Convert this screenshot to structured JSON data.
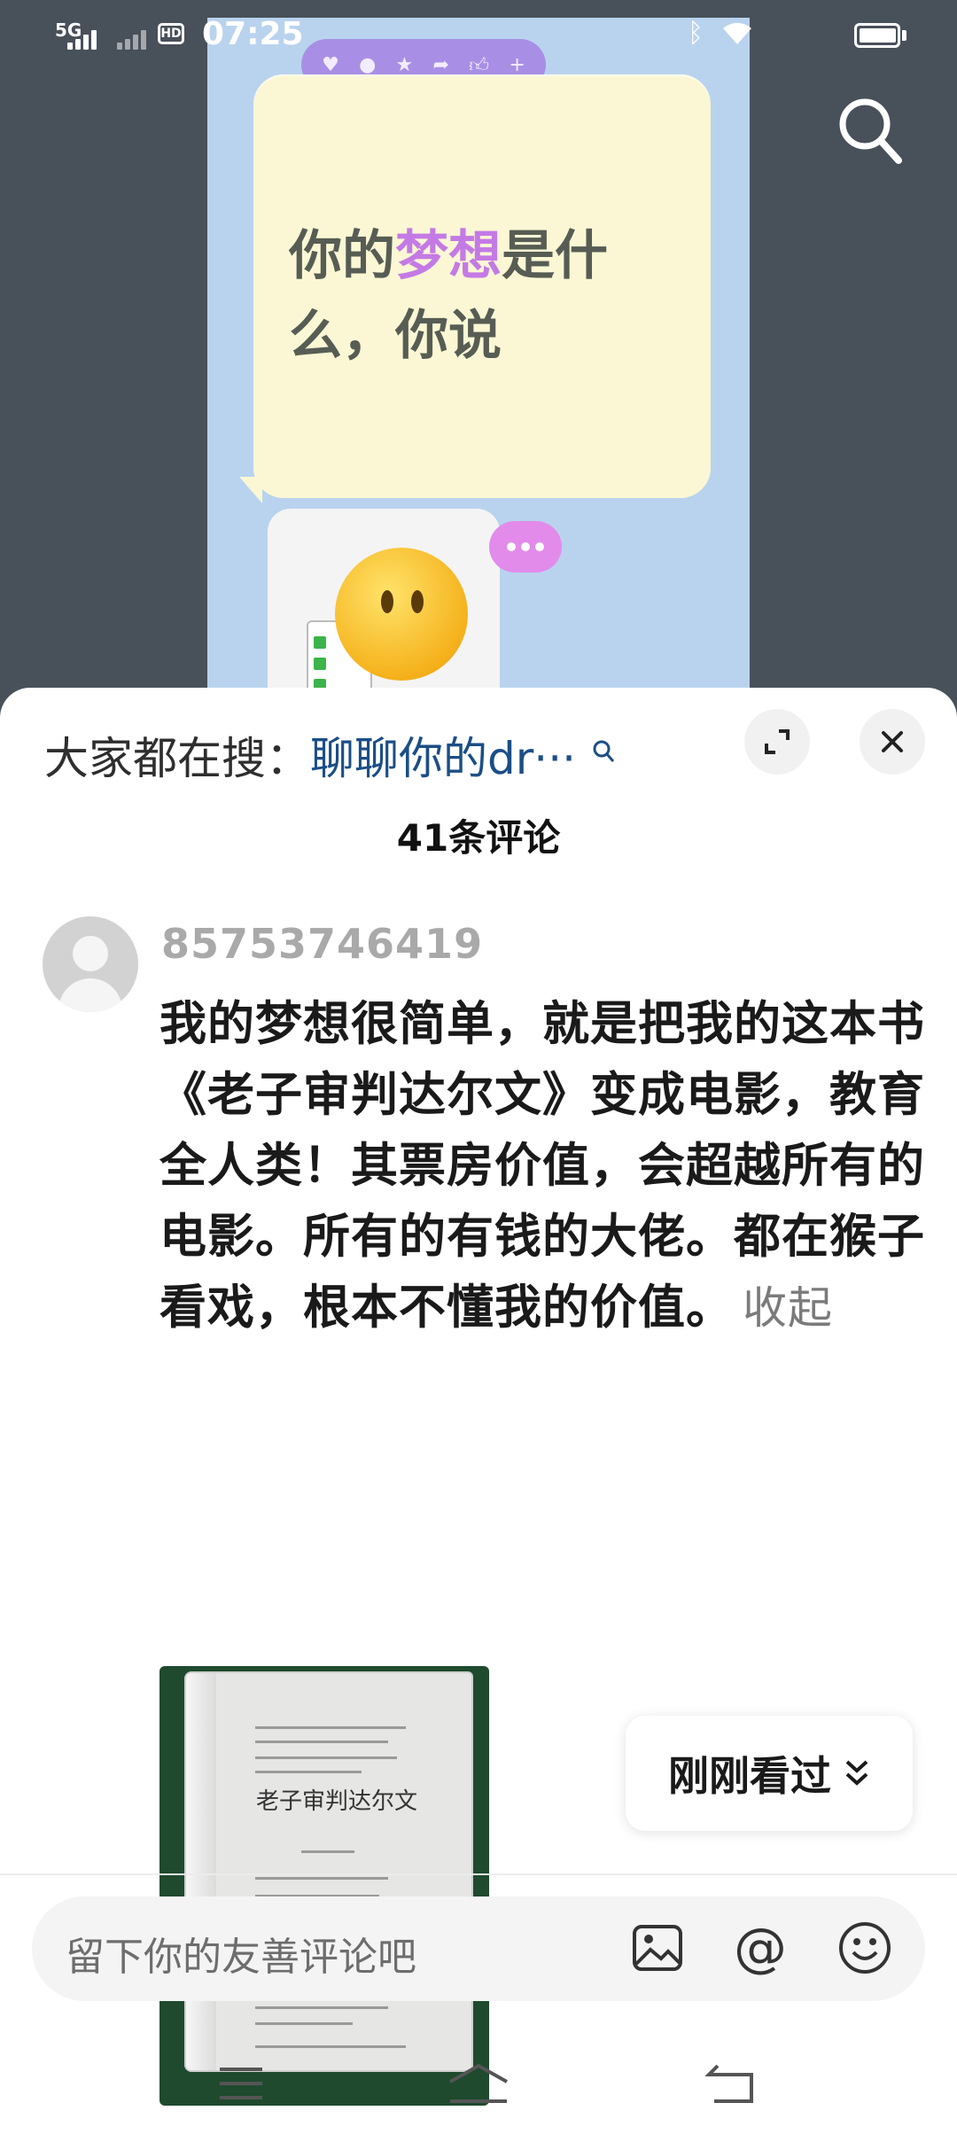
{
  "status_bar": {
    "time": "07:25",
    "network": "5G",
    "hd": "HD",
    "battery_level": 0.9
  },
  "video": {
    "note_text_before": "你的",
    "note_text_highlight": "梦想",
    "note_text_after": "是什么，你说",
    "reaction_icons": [
      "heart-icon",
      "chat-icon",
      "star-icon",
      "share-icon",
      "thumb-icon",
      "plus-icon"
    ],
    "highlight_color": "#c47ae4"
  },
  "sheet": {
    "hot_search_prefix": "大家都在搜：",
    "hot_search_keyword": "聊聊你的dr···",
    "comments_count": "41条评论"
  },
  "comment": {
    "username": "85753746419",
    "text": "我的梦想很简单，就是把我的这本书《老子审判达尔文》变成电影，教育全人类！其票房价值，会超越所有的电影。所有的有钱的大佬。都在猴子看戏，根本不懂我的价值。",
    "collapse_label": "收起",
    "photo_doc_title": "老子审判达尔文"
  },
  "recent_button": {
    "label": "刚刚看过"
  },
  "input": {
    "placeholder": "留下你的友善评论吧"
  }
}
